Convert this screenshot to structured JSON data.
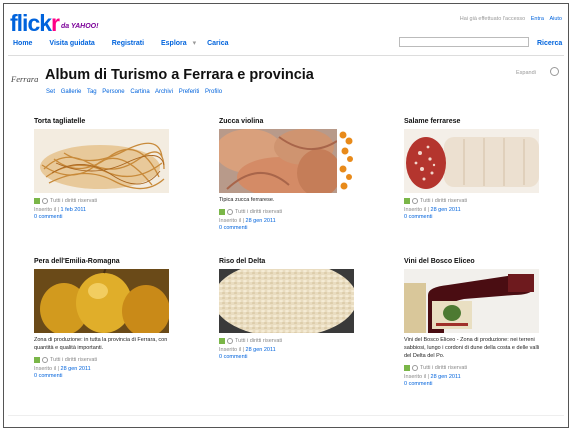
{
  "header": {
    "logo_primary": "flick",
    "logo_accent": "r",
    "logo_partner": "da YAHOO!",
    "signin_prompt": "Hai già effettuato l'accesso",
    "signin_label": "Entra",
    "help_label": "Aiuto",
    "nav": [
      "Home",
      "Visita guidata",
      "Registrati",
      "Esplora",
      "Carica"
    ],
    "explore_arrow": "▾",
    "search_label": "Ricerca"
  },
  "album": {
    "logo_text": "Ferrara",
    "title": "Album di Turismo a Ferrara e provincia",
    "subnav": [
      "Set",
      "Gallerie",
      "Tag",
      "Persone",
      "Cartina",
      "Archivi",
      "Preferiti",
      "Profilo"
    ],
    "share_label": "Espandi"
  },
  "photos": [
    {
      "title": "Torta tagliatelle",
      "description": "",
      "license": "Tutti i diritti riservati",
      "inserted_prefix": "Inserito il",
      "inserted_date": "1 feb 2011",
      "comments": "0 commenti"
    },
    {
      "title": "Zucca violina",
      "description": "Tipica zucca ferrarese.",
      "license": "Tutti i diritti riservati",
      "inserted_prefix": "Inserito il",
      "inserted_date": "28 gen 2011",
      "comments": "0 commenti"
    },
    {
      "title": "Salame ferrarese",
      "description": "",
      "license": "Tutti i diritti riservati",
      "inserted_prefix": "Inserito il",
      "inserted_date": "28 gen 2011",
      "comments": "0 commenti"
    },
    {
      "title": "Pera dell'Emilia-Romagna",
      "description": "Zona di produzione: in tutta la provincia di Ferrara, con quantità e qualità importanti.",
      "license": "Tutti i diritti riservati",
      "inserted_prefix": "Inserito il",
      "inserted_date": "28 gen 2011",
      "comments": "0 commenti"
    },
    {
      "title": "Riso del Delta",
      "description": "",
      "license": "Tutti i diritti riservati",
      "inserted_prefix": "Inserito il",
      "inserted_date": "28 gen 2011",
      "comments": "0 commenti"
    },
    {
      "title": "Vini del Bosco Eliceo",
      "description": "Vini del Bosco Eliceo - Zona di produzione: nei terreni sabbiosi, lungo i cordoni di dune della costa e delle valli del Delta del Po.",
      "license": "Tutti i diritti riservati",
      "inserted_prefix": "Inserito il",
      "inserted_date": "28 gen 2011",
      "comments": "0 commenti"
    }
  ],
  "colors": {
    "link": "#0063dc",
    "flickr_pink": "#ff0084",
    "license_green": "#7ab648"
  }
}
